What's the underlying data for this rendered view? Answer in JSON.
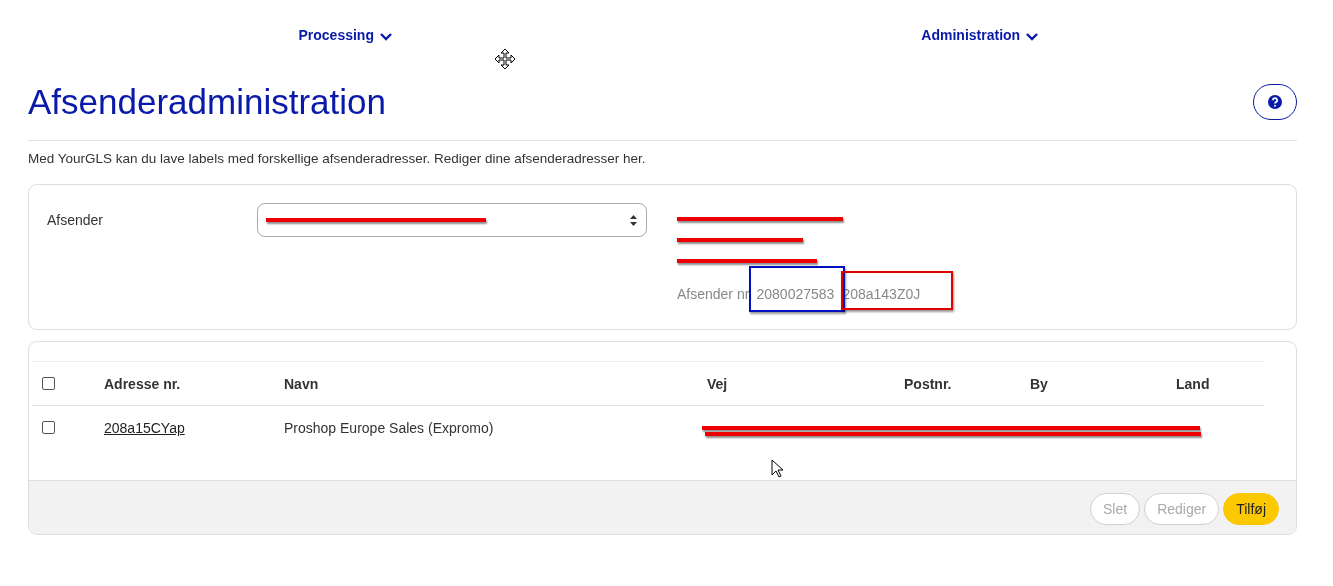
{
  "nav": [
    {
      "label": "Processing"
    },
    {
      "label": "Administration"
    }
  ],
  "title": "Afsenderadministration",
  "description": "Med YourGLS kan du lave labels med forskellige afsenderadresser. Rediger dine afsenderadresser her.",
  "sender": {
    "label": "Afsender",
    "select_redacted": true,
    "address_lines": [
      {
        "redacted": true
      },
      {
        "redacted": true
      },
      {
        "redacted": true
      }
    ],
    "number_label": "Afsender nr.",
    "number": "2080027583",
    "id": "208a143Z0J",
    "annotations": [
      {
        "color": "#0010c0"
      },
      {
        "color": "#e00000"
      }
    ]
  },
  "table": {
    "select_all": {
      "checked": false
    },
    "columns": [
      "Adresse nr.",
      "Navn",
      "Vej",
      "Postnr.",
      "By",
      "Land"
    ],
    "rows": [
      {
        "checked": false,
        "adresse_nr": "208a15CYap",
        "navn": "Proshop Europe Sales (Expromo)",
        "redacted": true
      }
    ]
  },
  "buttons": [
    {
      "label": "Slet",
      "kind": "secondary",
      "disabled": true
    },
    {
      "label": "Rediger",
      "kind": "secondary",
      "disabled": true
    },
    {
      "label": "Tilføj",
      "kind": "primary",
      "disabled": false
    }
  ]
}
